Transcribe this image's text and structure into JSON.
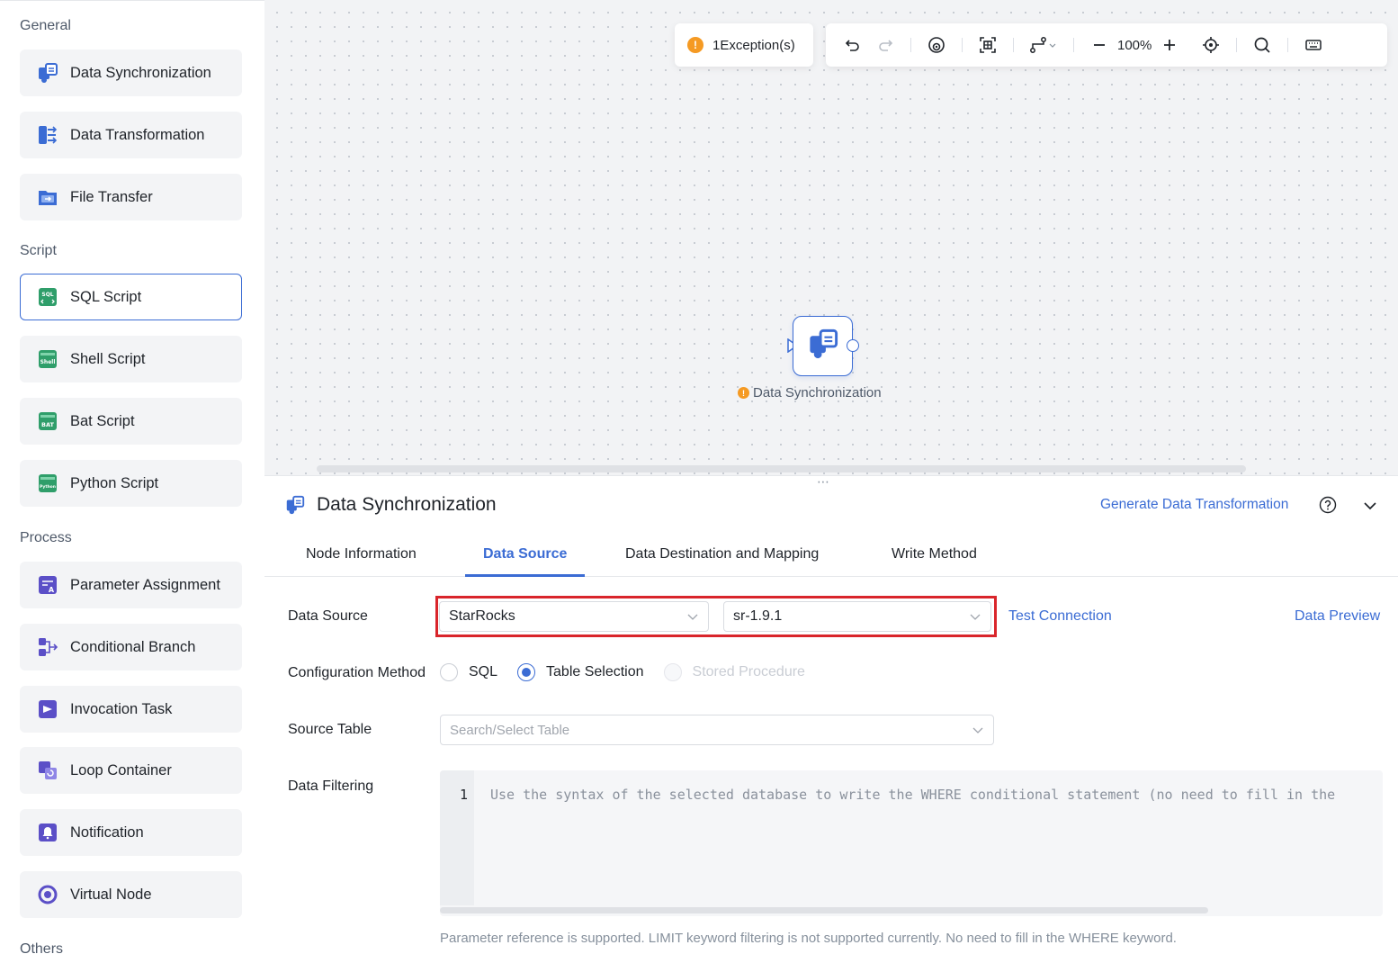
{
  "sidebar": {
    "sections": {
      "general": "General",
      "script": "Script",
      "process": "Process",
      "others": "Others"
    },
    "items": [
      {
        "label": "Data Synchronization",
        "icon": "data-sync-icon"
      },
      {
        "label": "Data Transformation",
        "icon": "data-transform-icon"
      },
      {
        "label": "File Transfer",
        "icon": "file-transfer-icon"
      },
      {
        "label": "SQL Script",
        "icon": "sql-icon",
        "active": true
      },
      {
        "label": "Shell Script",
        "icon": "shell-icon"
      },
      {
        "label": "Bat Script",
        "icon": "bat-icon"
      },
      {
        "label": "Python Script",
        "icon": "python-icon"
      },
      {
        "label": "Parameter Assignment",
        "icon": "parameter-icon"
      },
      {
        "label": "Conditional Branch",
        "icon": "branch-icon"
      },
      {
        "label": "Invocation Task",
        "icon": "invocation-icon"
      },
      {
        "label": "Loop Container",
        "icon": "loop-icon"
      },
      {
        "label": "Notification",
        "icon": "notification-icon"
      },
      {
        "label": "Virtual Node",
        "icon": "virtual-node-icon"
      }
    ]
  },
  "canvas": {
    "exception_text": "1Exception(s)",
    "zoom": "100%",
    "node_label": "Data Synchronization"
  },
  "panel": {
    "title": "Data Synchronization",
    "generate_link": "Generate Data Transformation",
    "tabs": [
      "Node Information",
      "Data Source",
      "Data Destination and Mapping",
      "Write Method"
    ],
    "active_tab": "Data Source",
    "form": {
      "data_source_label": "Data Source",
      "data_source_type": "StarRocks",
      "data_source_instance": "sr-1.9.1",
      "test_connection": "Test Connection",
      "data_preview": "Data Preview",
      "config_method_label": "Configuration Method",
      "config_options": [
        "SQL",
        "Table Selection",
        "Stored Procedure"
      ],
      "config_selected": "Table Selection",
      "source_table_label": "Source Table",
      "source_table_placeholder": "Search/Select Table",
      "data_filtering_label": "Data Filtering",
      "line_number": "1",
      "filter_placeholder": "Use the syntax of the selected database to write the WHERE conditional statement (no need to fill in the",
      "hint": "Parameter reference is supported. LIMIT keyword filtering is not supported currently. No need to fill in the WHERE keyword."
    }
  },
  "colors": {
    "accent": "#3b6cd4",
    "warning": "#f59a23",
    "highlight_frame": "#d9252b"
  }
}
